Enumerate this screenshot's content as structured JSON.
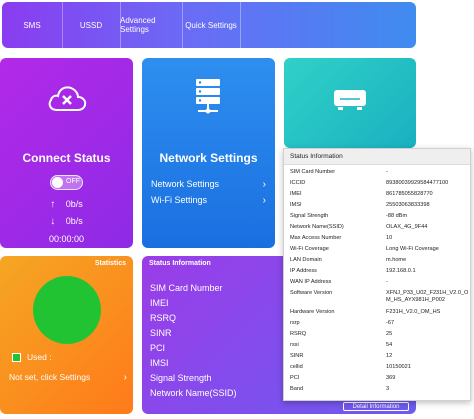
{
  "nav": {
    "items": [
      {
        "label": "SMS"
      },
      {
        "label": "USSD"
      },
      {
        "label": "Advanced Settings"
      },
      {
        "label": "Quick Settings"
      }
    ]
  },
  "connect": {
    "title": "Connect Status",
    "toggle_label": "OFF",
    "toggle_on": false,
    "upload_rate": "0b/s",
    "download_rate": "0b/s",
    "duration": "00:00:00"
  },
  "network": {
    "title": "Network Settings",
    "links": [
      "Network Settings",
      "Wi-Fi Settings"
    ]
  },
  "stats": {
    "title": "Statistics",
    "used_label": "Used :",
    "settings_link": "Not set, click Settings"
  },
  "status_card": {
    "title": "Status Information",
    "items": [
      "SIM Card Number",
      "IMEI",
      "RSRQ",
      "SINR",
      "PCI",
      "IMSI",
      "Signal Strength",
      "Network Name(SSID)"
    ],
    "detail_button": "Detail Information"
  },
  "popup": {
    "title": "Status Information",
    "rows": [
      {
        "label": "SIM Card Number",
        "value": "-"
      },
      {
        "label": "ICCID",
        "value": "89380039929584477100"
      },
      {
        "label": "IMEI",
        "value": "861785055828770"
      },
      {
        "label": "IMSI",
        "value": "25503063833398"
      },
      {
        "label": "Signal Strength",
        "value": "-88 dBm"
      },
      {
        "label": "Network Name(SSID)",
        "value": "OLAX_4G_9F44"
      },
      {
        "label": "Max Access Number",
        "value": "10"
      },
      {
        "label": "Wi-Fi Coverage",
        "value": "Long Wi-Fi Coverage"
      },
      {
        "label": "LAN Domain",
        "value": "m.home"
      },
      {
        "label": "IP Address",
        "value": "192.168.0.1"
      },
      {
        "label": "WAN IP Address",
        "value": "-"
      },
      {
        "label": "Software Version",
        "value": "XFNJ_P33_U02_F231H_V2.0_OM_HS_AYX981H_P002"
      },
      {
        "label": "Hardware Version",
        "value": "F231H_V2.0_OM_HS"
      },
      {
        "label": "rsrp",
        "value": "-67"
      },
      {
        "label": "RSRQ",
        "value": "25"
      },
      {
        "label": "rssi",
        "value": "54"
      },
      {
        "label": "SINR",
        "value": "12"
      },
      {
        "label": "cellid",
        "value": "10150021"
      },
      {
        "label": "PCI",
        "value": "369"
      },
      {
        "label": "Band",
        "value": "3"
      }
    ]
  },
  "colors": {
    "connect_card": "#a32be8",
    "network_card": "#2683ea",
    "device_card": "#26c4c6",
    "stats_card": "#f7931e",
    "used_swatch": "#22c332"
  },
  "icons": [
    "cloud-x-icon",
    "server-icon",
    "router-icon",
    "arrow-up-icon",
    "arrow-down-icon",
    "chevron-right-icon"
  ]
}
